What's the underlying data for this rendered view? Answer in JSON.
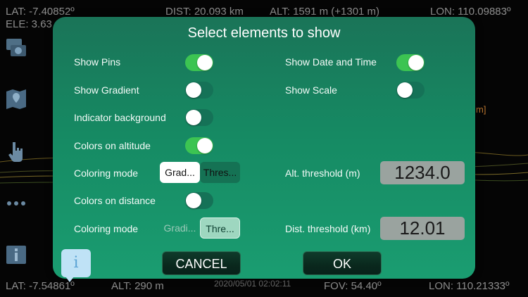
{
  "hud": {
    "lat_top": "LAT: -7.40852º",
    "ele_top": "ELE: 3.63",
    "dist_top": "DIST: 20.093 km",
    "alt_top": "ALT: 1591 m (+1301 m)",
    "lon_top": "LON: 110.09883º",
    "lat_bottom": "LAT: -7.54861º",
    "alt_bottom": "ALT: 290 m",
    "datetime": "2020/05/01  02:02:11",
    "fov": "FOV: 54.40º",
    "lon_bottom": "LON: 110.21333º",
    "scale_fragment": "m]"
  },
  "sidebar": {
    "icons": [
      "photo-camera-icon",
      "map-pin-icon",
      "hand-pointer-icon",
      "more-dots-icon",
      "info-panel-icon"
    ]
  },
  "dialog": {
    "title": "Select elements to show",
    "left": {
      "show_pins": {
        "label": "Show Pins",
        "on": true
      },
      "show_gradient": {
        "label": "Show Gradient",
        "on": false
      },
      "indicator_background": {
        "label": "Indicator background",
        "on": false
      },
      "colors_on_altitude": {
        "label": "Colors on altitude",
        "on": true
      },
      "coloring_mode_1": {
        "label": "Coloring mode",
        "options": [
          "Grad...",
          "Thres..."
        ],
        "selected": "Grad..."
      },
      "colors_on_distance": {
        "label": "Colors on distance",
        "on": false
      },
      "coloring_mode_2": {
        "label": "Coloring mode",
        "options": [
          "Gradi...",
          "Thre..."
        ],
        "selected": "Thre..."
      }
    },
    "right": {
      "show_date_time": {
        "label": "Show Date and Time",
        "on": true
      },
      "show_scale": {
        "label": "Show Scale",
        "on": false
      },
      "alt_threshold": {
        "label": "Alt. threshold (m)",
        "value": "1234.0"
      },
      "dist_threshold": {
        "label": "Dist. threshold (km)",
        "value": "12.01"
      }
    },
    "buttons": {
      "cancel": "CANCEL",
      "ok": "OK"
    },
    "info_glyph": "i"
  },
  "colors": {
    "dialog_bg": "#168a63",
    "toggle_on": "#3cc452",
    "accent_field": "#9aa39f"
  }
}
